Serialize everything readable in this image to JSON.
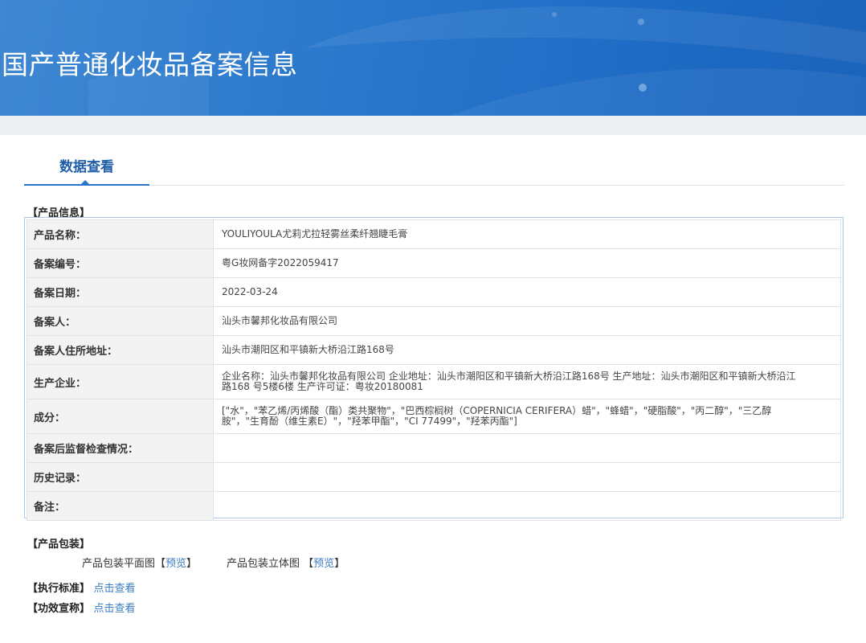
{
  "header": {
    "title": "国产普通化妆品备案信息"
  },
  "tabs": [
    {
      "label": "数据查看"
    }
  ],
  "product_info": {
    "section_label": "【产品信息】",
    "rows": [
      {
        "label": "产品名称：",
        "value": "YOULIYOULA尤莉尤拉轻雾丝柔纤翘睫毛膏"
      },
      {
        "label": "备案编号：",
        "value": "粤G妆网备字2022059417"
      },
      {
        "label": "备案日期：",
        "value": "2022-03-24"
      },
      {
        "label": "备案人：",
        "value": "汕头市馨邦化妆品有限公司"
      },
      {
        "label": "备案人住所地址：",
        "value": "汕头市潮阳区和平镇新大桥沿江路168号"
      },
      {
        "label": "生产企业：",
        "value": "企业名称：汕头市馨邦化妆品有限公司 企业地址：汕头市潮阳区和平镇新大桥沿江路168号 生产地址：汕头市潮阳区和平镇新大桥沿江路168 号5楼6楼 生产许可证：粤妆20180081"
      },
      {
        "label": "成分：",
        "value": "[\"水\"，\"苯乙烯/丙烯酸（酯）类共聚物\"，\"巴西棕榈树（COPERNICIA CERIFERA）蜡\"，\"蜂蜡\"，\"硬脂酸\"，\"丙二醇\"，\"三乙醇胺\"，\"生育酚（维生素E）\"，\"羟苯甲酯\"，\"CI 77499\"，\"羟苯丙酯\"]"
      },
      {
        "label": "备案后监督检查情况：",
        "value": ""
      },
      {
        "label": "历史记录：",
        "value": ""
      },
      {
        "label": "备注：",
        "value": ""
      }
    ]
  },
  "packaging": {
    "section_label": "【产品包装】",
    "flat": {
      "label": "产品包装平面图",
      "bracket_open": "【",
      "link": "预览",
      "bracket_close": "】"
    },
    "solid": {
      "label": "产品包装立体图",
      "bracket_open": "【",
      "link": "预览",
      "bracket_close": "】"
    }
  },
  "standard": {
    "label": "【执行标准】",
    "link": "点击查看"
  },
  "efficacy": {
    "label": "【功效宣称】",
    "link": "点击查看"
  },
  "colors": {
    "banner": "#2a78cc",
    "accent": "#2d75c9",
    "link": "#3b7cc4",
    "table_border": "#a9c9ea"
  }
}
